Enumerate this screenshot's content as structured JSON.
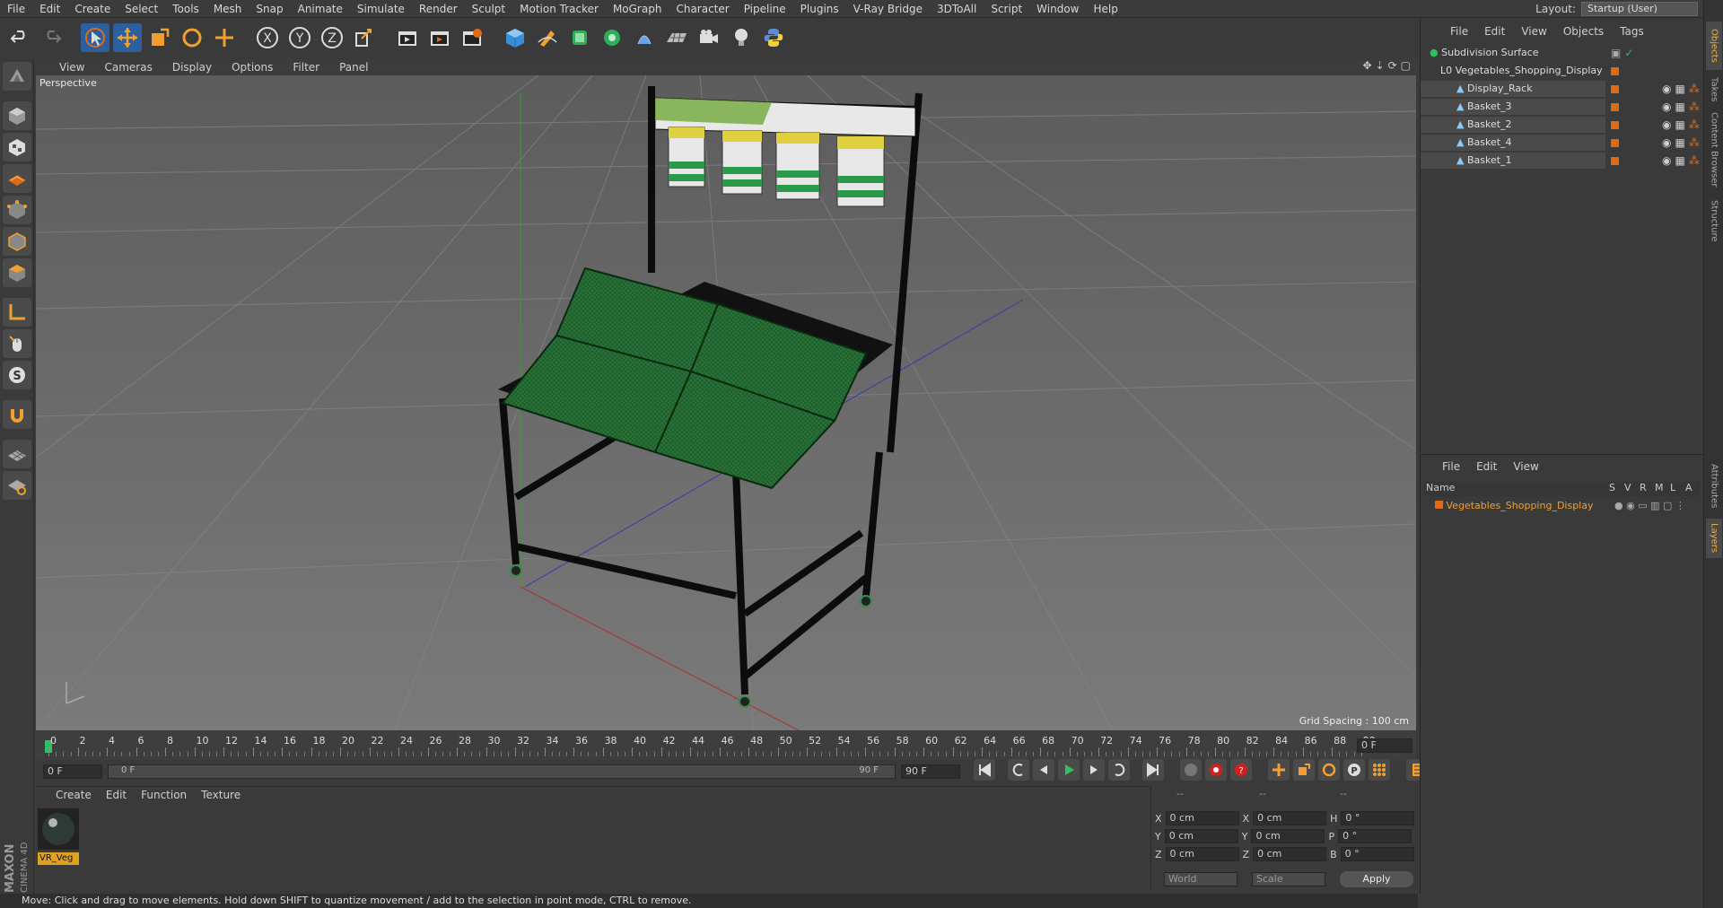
{
  "menubar": {
    "items": [
      "File",
      "Edit",
      "Create",
      "Select",
      "Tools",
      "Mesh",
      "Snap",
      "Animate",
      "Simulate",
      "Render",
      "Sculpt",
      "Motion Tracker",
      "MoGraph",
      "Character",
      "Pipeline",
      "Plugins",
      "V-Ray Bridge",
      "3DToAll",
      "Script",
      "Window",
      "Help"
    ],
    "layout_label": "Layout:",
    "layout_value": "Startup (User)"
  },
  "toolbar": {
    "icons": [
      "undo-icon",
      "redo-icon",
      "live-selection-icon",
      "move-icon",
      "scale-icon",
      "rotate-icon",
      "add-icon",
      "x-axis-icon",
      "y-axis-icon",
      "z-axis-icon",
      "coordinate-system-icon",
      "render-view-icon",
      "render-picture-viewer-icon",
      "edit-render-settings-icon",
      "cube-icon",
      "pen-icon",
      "nurbs-icon",
      "array-icon",
      "deformer-icon",
      "floor-icon",
      "camera-icon",
      "light-icon",
      "python-icon"
    ],
    "axis_labels": {
      "x": "X",
      "y": "Y",
      "z": "Z"
    }
  },
  "lefttools": {
    "icons": [
      "make-editable-icon",
      "model-mode-icon",
      "texture-mode-icon",
      "points-mode-icon",
      "edges-mode-icon",
      "polygons-mode-icon",
      "axis-mode-icon",
      "tweak-icon",
      "snap-icon",
      "magnet-icon",
      "workplane-icon",
      "locked-workplane-icon"
    ],
    "snap_label": "S"
  },
  "brand": {
    "maxon": "MAXON",
    "cinema": "CINEMA 4D"
  },
  "viewport": {
    "menu": [
      "View",
      "Cameras",
      "Display",
      "Options",
      "Filter",
      "Panel"
    ],
    "label": "Perspective",
    "grid_spacing": "Grid Spacing : 100 cm"
  },
  "timeline": {
    "ticks": [
      "0",
      "2",
      "4",
      "6",
      "8",
      "10",
      "12",
      "14",
      "16",
      "18",
      "20",
      "22",
      "24",
      "26",
      "28",
      "30",
      "32",
      "34",
      "36",
      "38",
      "40",
      "42",
      "44",
      "46",
      "48",
      "50",
      "52",
      "54",
      "56",
      "58",
      "60",
      "62",
      "64",
      "66",
      "68",
      "70",
      "72",
      "74",
      "76",
      "78",
      "80",
      "82",
      "84",
      "86",
      "88",
      "90"
    ],
    "current_frame": "0 F",
    "start_field": "0 F",
    "range_start": "0 F",
    "range_end": "90 F",
    "end_field": "90 F"
  },
  "material": {
    "menu": [
      "Create",
      "Edit",
      "Function",
      "Texture"
    ],
    "name": "VR_Veg"
  },
  "coords": {
    "header": "--",
    "rows": [
      {
        "a": "X",
        "av": "0 cm",
        "b": "X",
        "bv": "0 cm",
        "c": "H",
        "cv": "0 °"
      },
      {
        "a": "Y",
        "av": "0 cm",
        "b": "Y",
        "bv": "0 cm",
        "c": "P",
        "cv": "0 °"
      },
      {
        "a": "Z",
        "av": "0 cm",
        "b": "Z",
        "bv": "0 cm",
        "c": "B",
        "cv": "0 °"
      }
    ],
    "world": "World",
    "scale": "Scale",
    "apply": "Apply"
  },
  "objects": {
    "menu": [
      "File",
      "Edit",
      "View",
      "Objects",
      "Tags"
    ],
    "items": [
      {
        "name": "Subdivision Surface",
        "indent": 0
      },
      {
        "name": "Vegetables_Shopping_Display",
        "indent": 1
      },
      {
        "name": "Display_Rack",
        "indent": 2
      },
      {
        "name": "Basket_3",
        "indent": 2
      },
      {
        "name": "Basket_2",
        "indent": 2
      },
      {
        "name": "Basket_4",
        "indent": 2
      },
      {
        "name": "Basket_1",
        "indent": 2
      }
    ]
  },
  "layers": {
    "menu": [
      "File",
      "Edit",
      "View"
    ],
    "headers": [
      "Name",
      "S",
      "V",
      "R",
      "M",
      "L",
      "A"
    ],
    "item": "Vegetables_Shopping_Display"
  },
  "sidetabs": [
    "Objects",
    "Takes",
    "Content Browser",
    "Structure",
    "Attributes",
    "Layers"
  ],
  "status": "Move: Click and drag to move elements. Hold down SHIFT to quantize movement / add to the selection in point mode, CTRL to remove.",
  "colors": {
    "accent": "#e06b16",
    "layer": "#f0a030",
    "basket": "#1e5a2a"
  }
}
